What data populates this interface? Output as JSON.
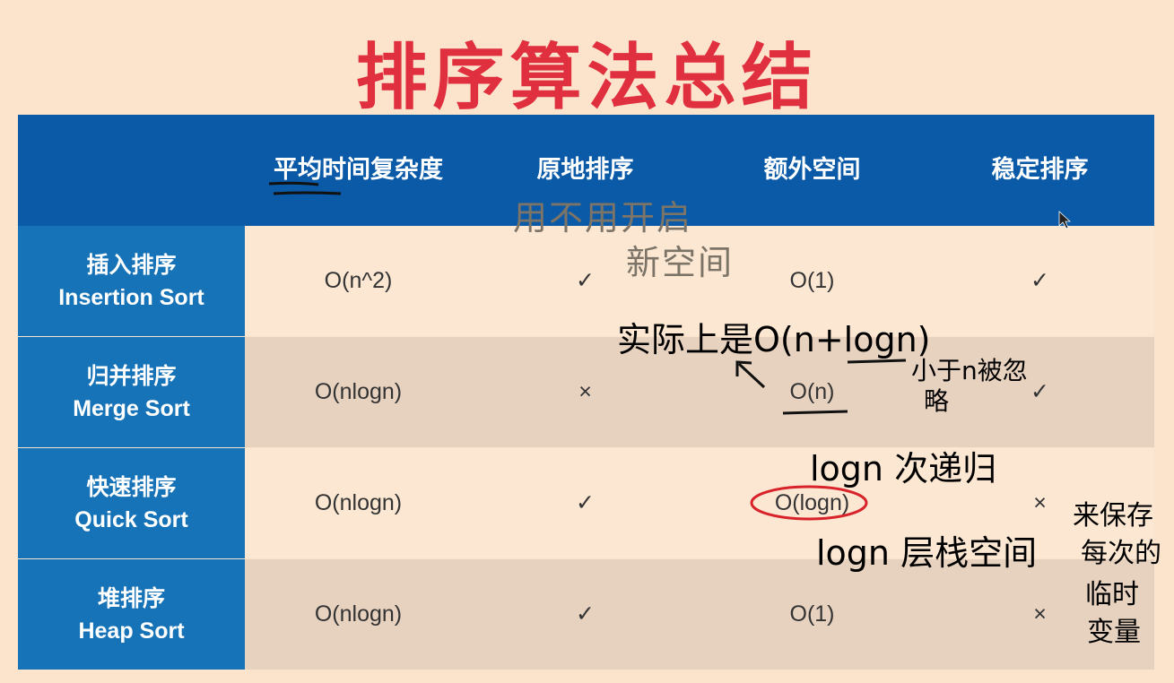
{
  "title": "排序算法总结",
  "headers": [
    "平均时间复杂度",
    "原地排序",
    "额外空间",
    "稳定排序"
  ],
  "rows": [
    {
      "zh": "插入排序",
      "en": "Insertion Sort",
      "avg": "O(n^2)",
      "inplace": "✓",
      "space": "O(1)",
      "stable": "✓"
    },
    {
      "zh": "归并排序",
      "en": "Merge Sort",
      "avg": "O(nlogn)",
      "inplace": "×",
      "space": "O(n)",
      "stable": "✓"
    },
    {
      "zh": "快速排序",
      "en": "Quick Sort",
      "avg": "O(nlogn)",
      "inplace": "✓",
      "space": "O(logn)",
      "stable": "×"
    },
    {
      "zh": "堆排序",
      "en": "Heap Sort",
      "avg": "O(nlogn)",
      "inplace": "✓",
      "space": "O(1)",
      "stable": "×"
    }
  ],
  "annotations": {
    "note1a": "用不用开启",
    "note1b": "新空间",
    "note2": "实际上是O(n+logn)",
    "note3a": "小于n被忽",
    "note3b": "略",
    "note4": "logn 次递归",
    "note5": "logn 层栈空间",
    "note6a": "来保存",
    "note6b": "每次的",
    "note6c": "临时",
    "note6d": "变量"
  },
  "colors": {
    "background": "#fbe3cc",
    "title": "#e0303f",
    "header": "#0b5aa8",
    "row_label": "#1773b7",
    "row_light": "#fce7d3",
    "row_dark": "#e7d2c0",
    "ink_red": "#d8232a"
  }
}
